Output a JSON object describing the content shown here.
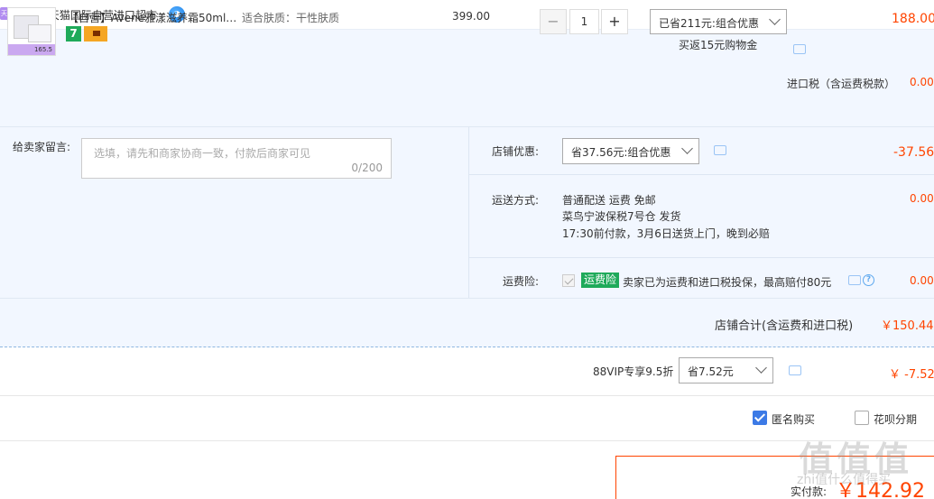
{
  "shop": {
    "icon_text": "天猫",
    "label": "店铺: 天猫国际自营进口超市"
  },
  "item": {
    "title": "【自营】Avene雅漾滋养霜50ml…",
    "skin_type": "适合肤质：干性肤质",
    "thumb_price": "165.5",
    "badge": "7",
    "unit_price": "399.00",
    "qty_minus": "−",
    "qty_value": "1",
    "qty_plus": "+",
    "promo_selected": "已省211元:组合优惠",
    "cashback": "买返15元购物金",
    "total": "188.00"
  },
  "tax": {
    "label": "进口税（含运费税款）",
    "value": "0.00"
  },
  "message": {
    "label": "给卖家留言:",
    "placeholder": "选填，请先和商家协商一致，付款后商家可见",
    "count": "0/200"
  },
  "shop_discount": {
    "label": "店铺优惠:",
    "selected": "省37.56元:组合优惠",
    "value": "-37.56"
  },
  "shipping": {
    "label": "运送方式:",
    "line1": "普通配送 运费 免邮",
    "line2": "菜鸟宁波保税7号仓   发货",
    "line3": "17:30前付款，3月6日送货上门，晚到必赔",
    "value": "0.00"
  },
  "insurance": {
    "label": "运费险:",
    "tag": "运费险",
    "text": "卖家已为运费和进口税投保，最高赔付80元",
    "help": "?",
    "value": "0.00"
  },
  "shop_total": {
    "label": "店铺合计(含运费和进口税)",
    "value": "￥150.44"
  },
  "vip": {
    "label": "88VIP专享9.5折",
    "selected": "省7.52元",
    "value": "￥ -7.52"
  },
  "options": {
    "anonymous": "匿名购买",
    "huabei": "花呗分期"
  },
  "payment": {
    "label": "实付款:",
    "value": "￥142.92"
  },
  "watermark": {
    "main": "值值值",
    "sub": "zhi值什么值得买"
  },
  "colors": {
    "accent_red": "#ff4400",
    "panel_bg": "#f2f7ff",
    "checkbox_blue": "#3c7ae6",
    "insurance_green": "#1faa5a"
  }
}
